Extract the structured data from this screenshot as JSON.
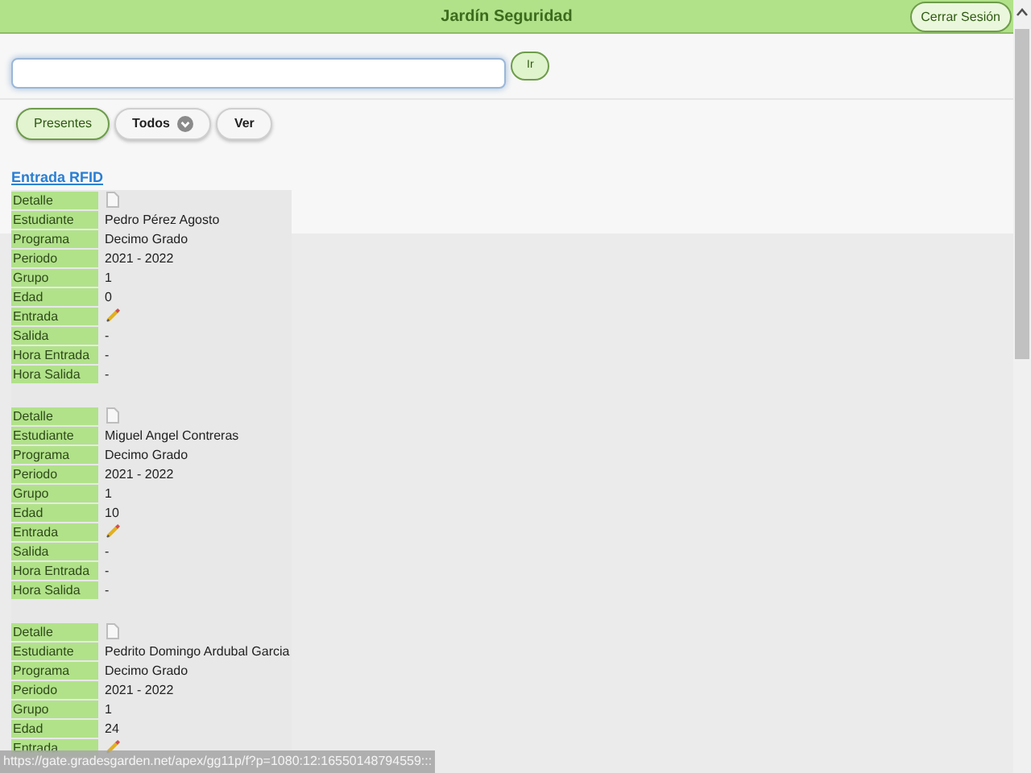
{
  "header": {
    "title": "Jardín Seguridad",
    "logout_button": "Cerrar Sesión"
  },
  "search": {
    "button": "Ir"
  },
  "filters": [
    {
      "label": "Presentes",
      "selected": true,
      "kind": "plain"
    },
    {
      "label": "Todos",
      "selected": false,
      "kind": "dropdown"
    },
    {
      "label": "Ver",
      "selected": false,
      "kind": "plain"
    }
  ],
  "link": "Entrada RFID",
  "records": [
    {
      "rows": [
        {
          "label": "Detalle",
          "kind": "doc"
        },
        {
          "label": "Estudiante",
          "value": "Pedro Pérez Agosto"
        },
        {
          "label": "Programa",
          "value": "Decimo Grado"
        },
        {
          "label": "Periodo",
          "value": "2021 - 2022"
        },
        {
          "label": "Grupo",
          "value": "1"
        },
        {
          "label": "Edad",
          "value": "0"
        },
        {
          "label": "Entrada",
          "kind": "pencil"
        },
        {
          "label": "Salida",
          "value": "-"
        },
        {
          "label": "Hora Entrada",
          "value": "-"
        },
        {
          "label": "Hora Salida",
          "value": "-"
        }
      ]
    },
    {
      "rows": [
        {
          "label": "Detalle",
          "kind": "doc"
        },
        {
          "label": "Estudiante",
          "value": "Miguel Angel Contreras"
        },
        {
          "label": "Programa",
          "value": "Decimo Grado"
        },
        {
          "label": "Periodo",
          "value": "2021 - 2022"
        },
        {
          "label": "Grupo",
          "value": "1"
        },
        {
          "label": "Edad",
          "value": "10"
        },
        {
          "label": "Entrada",
          "kind": "pencil"
        },
        {
          "label": "Salida",
          "value": "-"
        },
        {
          "label": "Hora Entrada",
          "value": "-"
        },
        {
          "label": "Hora Salida",
          "value": "-"
        }
      ]
    },
    {
      "rows": [
        {
          "label": "Detalle",
          "kind": "doc"
        },
        {
          "label": "Estudiante",
          "value": "Pedrito Domingo Ardubal Garcia"
        },
        {
          "label": "Programa",
          "value": "Decimo Grado"
        },
        {
          "label": "Periodo",
          "value": "2021 - 2022"
        },
        {
          "label": "Grupo",
          "value": "1"
        },
        {
          "label": "Edad",
          "value": "24"
        },
        {
          "label": "Entrada",
          "kind": "pencil"
        }
      ]
    }
  ],
  "status_url": "https://gate.gradesgarden.net/apex/gg11p/f?p=1080:12:16550148794559:::"
}
